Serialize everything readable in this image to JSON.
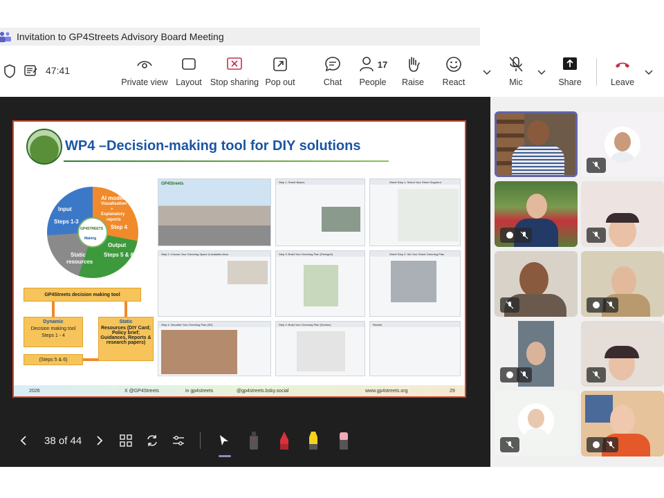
{
  "window": {
    "title": "Invitation to GP4Streets Advisory Board Meeting",
    "timer": "47:41"
  },
  "toolbar": {
    "private_view": "Private view",
    "layout": "Layout",
    "stop_sharing": "Stop sharing",
    "pop_out": "Pop out",
    "chat": "Chat",
    "people": "People",
    "people_count": "17",
    "raise": "Raise",
    "react": "React",
    "mic": "Mic",
    "share": "Share",
    "leave": "Leave"
  },
  "colors": {
    "leave": "#c4314b",
    "accent": "#6264a7",
    "stop": "#c4314b"
  },
  "slide": {
    "title": "WP4 –Decision-making tool for DIY solutions",
    "cycle": {
      "input": "Input",
      "steps13": "Steps 1-3",
      "ai_models": "AI models",
      "visualisation": "Visualisation",
      "plus": "+",
      "explanatory": "Explanatory",
      "reports": "reports",
      "step4": "Step 4",
      "output": "Output",
      "steps56": "Steps 5 & 6",
      "static": "Static",
      "resources": "resources",
      "center": "GP4STREETS",
      "making": "Making"
    },
    "diagram": {
      "header": "GP4Streets decision making tool",
      "dynamic": "Dynamic",
      "dyn_sub": "Decision making tool",
      "dyn_steps": "Steps 1 - 4",
      "static": "Static",
      "static_sub": "Resources (DIY Card; Policy brief; Guidances, Reports & research papers)",
      "steps56": "(Steps 5 & 6)"
    },
    "thumbs": {
      "t1_brand": "GP4Streets",
      "t2": "Step 2: Choose Your Greening Space & Available Area",
      "t3": "Step 4: Visualise Your Greening Plan (3D)",
      "t4": "Step 1: Street Basics",
      "t5": "Step 3: Build Your Greening Plan (Plan/grid)",
      "t6": "Step 3: Build Your Greening Plan (Section)",
      "t7": "Street Step 1: Select Your Street Segment",
      "t8": "Street Step 2: Set Your Street Greening Plan",
      "t9": "Results"
    },
    "footer": {
      "year": "2026",
      "x": "X @GP4Streets",
      "in": "in gp4streets",
      "bsky": "@gp4streets.bsky.social",
      "web": "www.gp4streets.org",
      "page": "29"
    }
  },
  "presenter": {
    "page_counter": "38 of 44"
  }
}
